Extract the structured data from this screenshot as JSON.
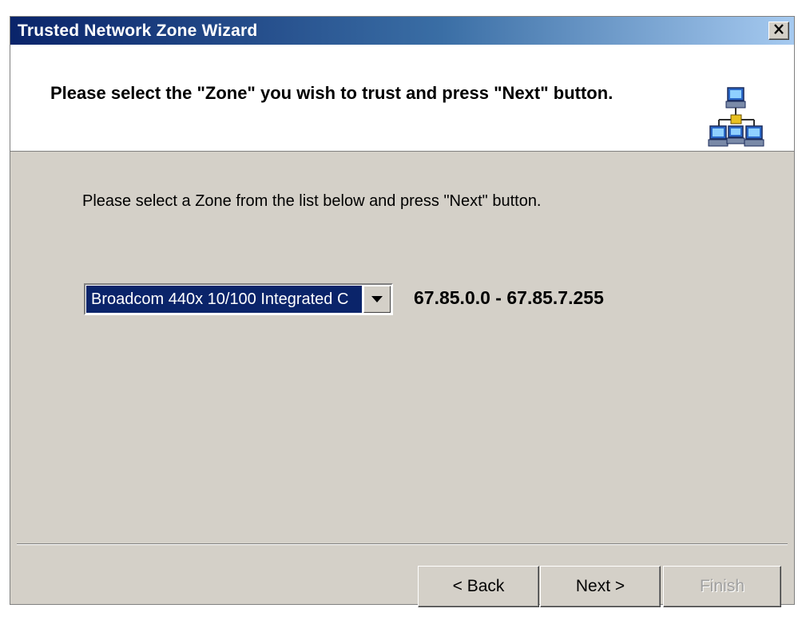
{
  "window": {
    "title": "Trusted Network Zone Wizard",
    "close_icon": "close-icon"
  },
  "header": {
    "heading": "Please select the \"Zone\" you wish to trust and press \"Next\" button.",
    "icon": "network-computers-icon"
  },
  "main": {
    "instruction": "Please select a Zone from the list below and press \"Next\" button.",
    "zone_select": {
      "value": "Broadcom 440x 10/100 Integrated C",
      "arrow_icon": "dropdown-arrow-icon"
    },
    "ip_range": "67.85.0.0 - 67.85.7.255"
  },
  "buttons": {
    "back": "< Back",
    "next": "Next >",
    "finish": "Finish",
    "finish_disabled": true
  },
  "colors": {
    "title_start": "#0a246a",
    "title_end": "#a6caf0",
    "dialog_bg": "#d4d0c8",
    "selection": "#0a246a"
  }
}
